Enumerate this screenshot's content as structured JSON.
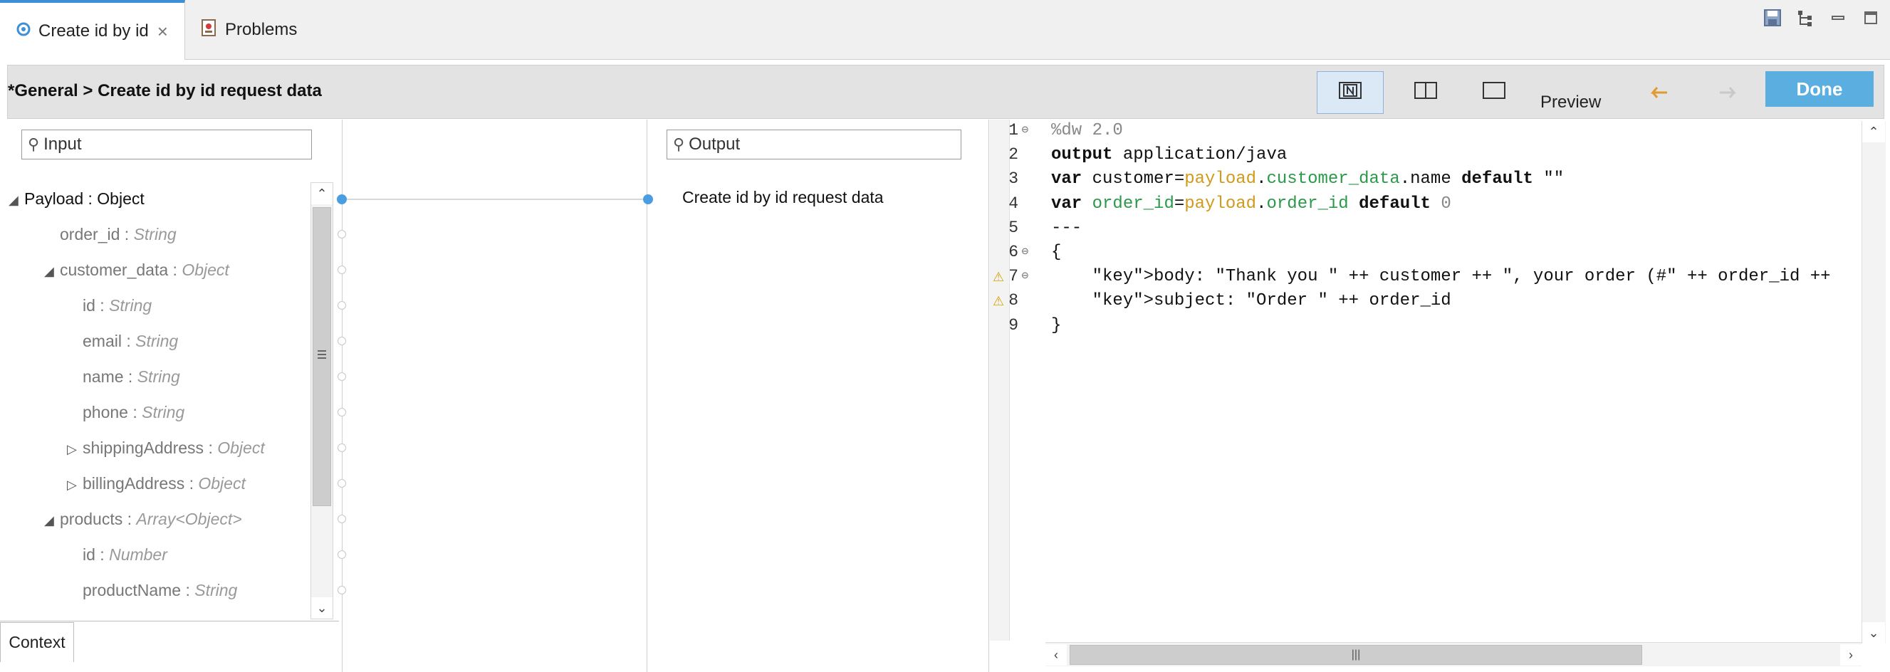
{
  "tabs": [
    {
      "label": "Create id by id",
      "icon": "dataweave-icon",
      "active": true
    },
    {
      "label": "Problems",
      "icon": "problems-icon",
      "active": false
    }
  ],
  "window_icons": [
    "save-icon",
    "tree-icon",
    "minimize-icon",
    "maximize-icon"
  ],
  "breadcrumb": "*General > Create id by id request data",
  "toolbar": {
    "preview_label": "Preview",
    "done_label": "Done",
    "view_buttons": [
      "n-view-icon",
      "split-view-icon",
      "single-view-icon"
    ]
  },
  "input": {
    "search_placeholder": "Input",
    "tree": [
      {
        "name": "Payload",
        "type": "Object",
        "depth": 0,
        "toggle": "expanded"
      },
      {
        "name": "order_id",
        "type": "String",
        "depth": 1,
        "toggle": "none"
      },
      {
        "name": "customer_data",
        "type": "Object",
        "depth": 1,
        "toggle": "expanded"
      },
      {
        "name": "id",
        "type": "String",
        "depth": 2,
        "toggle": "none"
      },
      {
        "name": "email",
        "type": "String",
        "depth": 2,
        "toggle": "none"
      },
      {
        "name": "name",
        "type": "String",
        "depth": 2,
        "toggle": "none"
      },
      {
        "name": "phone",
        "type": "String",
        "depth": 2,
        "toggle": "none"
      },
      {
        "name": "shippingAddress",
        "type": "Object",
        "depth": 2,
        "toggle": "collapsed"
      },
      {
        "name": "billingAddress",
        "type": "Object",
        "depth": 2,
        "toggle": "collapsed"
      },
      {
        "name": "products",
        "type": "Array<Object>",
        "depth": 1,
        "toggle": "expanded"
      },
      {
        "name": "id",
        "type": "Number",
        "depth": 2,
        "toggle": "none"
      },
      {
        "name": "productName",
        "type": "String",
        "depth": 2,
        "toggle": "none"
      }
    ],
    "context_tab": "Context"
  },
  "output": {
    "search_placeholder": "Output",
    "root_label": "Create id by id request data"
  },
  "editor": {
    "lines": [
      {
        "n": "1",
        "text": "%dw 2.0",
        "fold": true,
        "warn": false
      },
      {
        "n": "2",
        "text": "output application/java",
        "fold": false,
        "warn": false
      },
      {
        "n": "3",
        "text": "var customer=payload.customer_data.name default \"\"",
        "fold": false,
        "warn": false
      },
      {
        "n": "4",
        "text": "var order_id=payload.order_id default 0",
        "fold": false,
        "warn": false
      },
      {
        "n": "5",
        "text": "---",
        "fold": false,
        "warn": false
      },
      {
        "n": "6",
        "text": "{",
        "fold": true,
        "warn": false
      },
      {
        "n": "7",
        "text": "    body: \"Thank you \" ++ customer ++ \", your order (#\" ++ order_id ++",
        "fold": true,
        "warn": true
      },
      {
        "n": "8",
        "text": "    subject: \"Order \" ++ order_id",
        "fold": false,
        "warn": true
      },
      {
        "n": "9",
        "text": "}",
        "fold": false,
        "warn": false
      }
    ]
  },
  "colors": {
    "accent": "#3d8fd6",
    "done": "#5aaee0",
    "connector": "#4a9de0",
    "payload": "#d19a1a",
    "field": "#2a9a4a",
    "warning": "#e0b000"
  }
}
